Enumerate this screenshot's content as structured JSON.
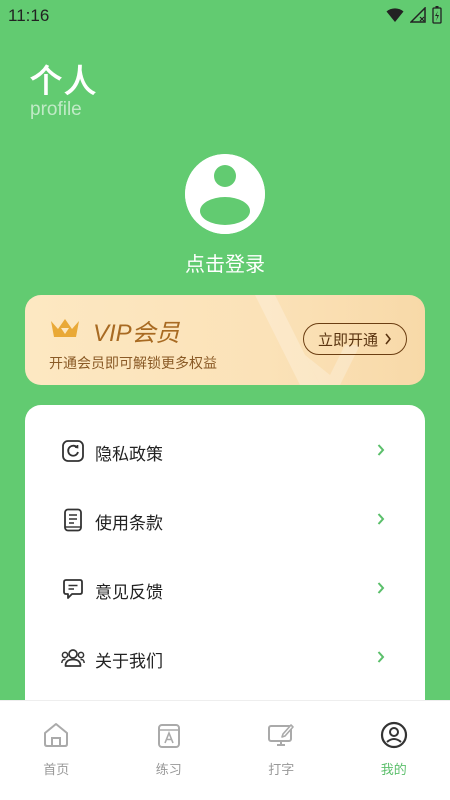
{
  "status_bar": {
    "time": "11:16"
  },
  "header": {
    "title": "个人",
    "subtitle": "profile"
  },
  "profile": {
    "login_text": "点击登录"
  },
  "vip": {
    "title": "VIP会员",
    "subtitle": "开通会员即可解锁更多权益",
    "button_label": "立即开通",
    "accent": "#a86a22"
  },
  "menu": {
    "items": [
      {
        "label": "隐私政策",
        "icon": "privacy-icon"
      },
      {
        "label": "使用条款",
        "icon": "terms-icon"
      },
      {
        "label": "意见反馈",
        "icon": "feedback-icon"
      },
      {
        "label": "关于我们",
        "icon": "about-icon"
      }
    ]
  },
  "tabbar": {
    "active_color": "#5bbf6b",
    "tabs": [
      {
        "label": "首页",
        "icon": "home-icon"
      },
      {
        "label": "练习",
        "icon": "practice-icon"
      },
      {
        "label": "打字",
        "icon": "typing-icon"
      },
      {
        "label": "我的",
        "icon": "profile-icon",
        "active": true
      }
    ]
  }
}
